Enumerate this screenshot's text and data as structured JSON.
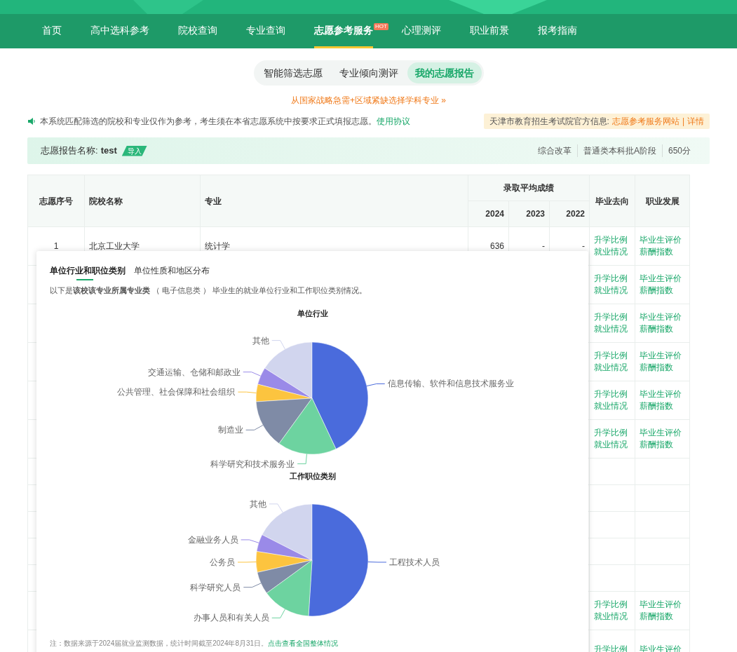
{
  "nav": {
    "items": [
      {
        "label": "首页",
        "selected": false
      },
      {
        "label": "高中选科参考",
        "selected": false
      },
      {
        "label": "院校查询",
        "selected": false
      },
      {
        "label": "专业查询",
        "selected": false
      },
      {
        "label": "志愿参考服务",
        "selected": true,
        "badge": "HOT"
      },
      {
        "label": "心理测评",
        "selected": false
      },
      {
        "label": "职业前景",
        "selected": false
      },
      {
        "label": "报考指南",
        "selected": false
      }
    ]
  },
  "segments": [
    {
      "label": "智能筛选志愿",
      "selected": false
    },
    {
      "label": "专业倾向测评",
      "selected": false
    },
    {
      "label": "我的志愿报告",
      "selected": true
    }
  ],
  "promo_link": "从国家战略急需+区域紧缺选择学科专业 »",
  "notice": {
    "text": "本系统匹配筛选的院校和专业仅作为参考，考生须在本省志愿系统中按要求正式填报志愿。",
    "link": "使用协议"
  },
  "official_info": {
    "label": "天津市教育招生考试院官方信息:",
    "link": "志愿参考服务网站",
    "separator": "|",
    "detail": "详情"
  },
  "report": {
    "label": "志愿报告名称:",
    "name": "test",
    "tag": "导入",
    "meta": [
      "综合改革",
      "普通类本科批A阶段",
      "650分"
    ]
  },
  "table": {
    "columns": [
      "志愿序号",
      "院校名称",
      "专业"
    ],
    "score_group": "录取平均成绩",
    "years": [
      "2024",
      "2023",
      "2022"
    ],
    "columns_after": [
      "毕业去向",
      "职业发展"
    ],
    "rows": [
      {
        "kind": "full",
        "cells": [
          "1",
          "北京工业大学",
          "统计学",
          "636",
          "-",
          "-"
        ],
        "destination": [
          "升学比例",
          "就业情况"
        ],
        "career": [
          "毕业生评价",
          "薪酬指数"
        ]
      },
      {
        "kind": "links",
        "destination": [
          "升学比例",
          "就业情况"
        ],
        "career": [
          "毕业生评价",
          "薪酬指数"
        ]
      },
      {
        "kind": "links",
        "destination": [
          "升学比例",
          "就业情况"
        ],
        "career": [
          "毕业生评价",
          "薪酬指数"
        ]
      },
      {
        "kind": "links",
        "destination": [
          "升学比例",
          "就业情况"
        ],
        "career": [
          "毕业生评价",
          "薪酬指数"
        ]
      },
      {
        "kind": "links",
        "destination": [
          "升学比例",
          "就业情况"
        ],
        "career": [
          "毕业生评价",
          "薪酬指数"
        ]
      },
      {
        "kind": "links",
        "destination": [
          "升学比例",
          "就业情况"
        ],
        "career": [
          "毕业生评价",
          "薪酬指数"
        ]
      },
      {
        "kind": "blank"
      },
      {
        "kind": "blank"
      },
      {
        "kind": "blank"
      },
      {
        "kind": "blank"
      },
      {
        "kind": "blank"
      },
      {
        "kind": "links",
        "destination": [
          "升学比例",
          "就业情况"
        ],
        "career": [
          "毕业生评价",
          "薪酬指数"
        ]
      },
      {
        "kind": "links",
        "destination": [
          "升学比例"
        ],
        "career": [
          "毕业生评价"
        ]
      }
    ]
  },
  "popup": {
    "tabs": [
      {
        "label": "单位行业和职位类别",
        "selected": true
      },
      {
        "label": "单位性质和地区分布",
        "selected": false
      }
    ],
    "description": "以下是**该校该专业所属专业类** （ 电子信息类 ） 毕业生的就业单位行业和工作职位类别情况。",
    "charts": [
      {
        "title": "单位行业",
        "slices": [
          {
            "label": "其他",
            "color": "#d1d5ee"
          },
          {
            "label": "交通运输、仓储和邮政业",
            "color": "#9a8ae8"
          },
          {
            "label": "公共管理、社会保障和社会组织",
            "color": "#fcc43f"
          },
          {
            "label": "信息传输、软件和信息技术服务业",
            "color": "#4a6bdc"
          },
          {
            "label": "制造业",
            "color": "#7f8ba6"
          },
          {
            "label": "科学研究和技术服务业",
            "color": "#6dd3a0"
          }
        ]
      },
      {
        "title": "工作职位类别",
        "slices": [
          {
            "label": "其他",
            "color": "#d1d5ee"
          },
          {
            "label": "金融业务人员",
            "color": "#9a8ae8"
          },
          {
            "label": "公务员",
            "color": "#fcc43f"
          },
          {
            "label": "工程技术人员",
            "color": "#4a6bdc"
          },
          {
            "label": "科学研究人员",
            "color": "#7f8ba6"
          },
          {
            "label": "办事人员和有关人员",
            "color": "#6dd3a0"
          }
        ]
      }
    ],
    "note": "注：数据来源于2024届就业监测数据，统计时间截至2024年8月31日。",
    "note_link": "点击查看全国整体情况"
  }
}
